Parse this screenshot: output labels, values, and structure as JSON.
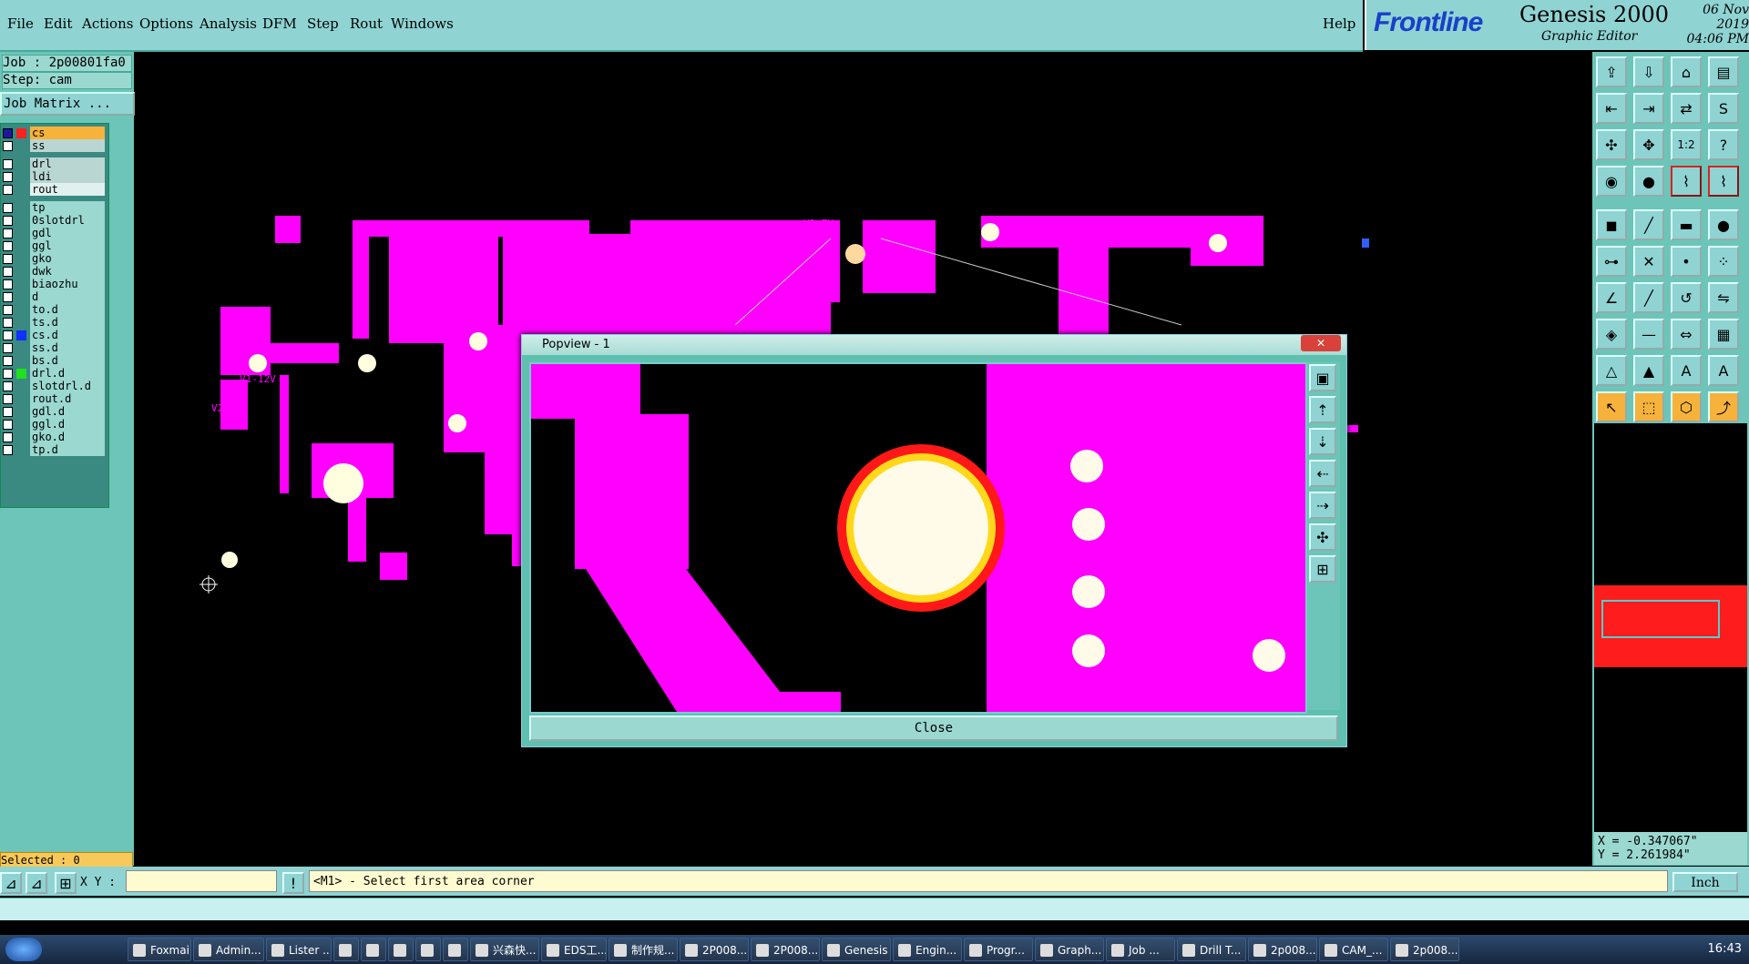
{
  "menu": [
    "File",
    "Edit",
    "Actions",
    "Options",
    "Analysis",
    "DFM",
    "Step",
    "Rout",
    "Windows"
  ],
  "help": "Help",
  "brand": {
    "logo": "Frontline",
    "product": "Genesis 2000",
    "sub": "Graphic Editor",
    "date": "06 Nov 2019",
    "time": "04:06 PM"
  },
  "job": {
    "job_line": "Job : 2p00801fa0",
    "step_line": "Step: cam",
    "matrix_button": "Job Matrix ..."
  },
  "layers": [
    {
      "name": "cs",
      "color": "#ff2020",
      "state": "active"
    },
    {
      "name": "ss",
      "color": "",
      "state": "board"
    },
    {
      "name": "drl",
      "color": "",
      "state": "board"
    },
    {
      "name": "ldi",
      "color": "",
      "state": "board"
    },
    {
      "name": "rout",
      "color": "",
      "state": "plain"
    },
    {
      "name": "tp",
      "color": "",
      "state": "misc"
    },
    {
      "name": "0slotdrl",
      "color": "",
      "state": "misc"
    },
    {
      "name": "gdl",
      "color": "",
      "state": "misc"
    },
    {
      "name": "ggl",
      "color": "",
      "state": "misc"
    },
    {
      "name": "gko",
      "color": "",
      "state": "misc"
    },
    {
      "name": "dwk",
      "color": "",
      "state": "misc"
    },
    {
      "name": "biaozhu",
      "color": "",
      "state": "misc"
    },
    {
      "name": "d",
      "color": "",
      "state": "misc"
    },
    {
      "name": "to.d",
      "color": "",
      "state": "misc"
    },
    {
      "name": "ts.d",
      "color": "",
      "state": "misc"
    },
    {
      "name": "cs.d",
      "color": "#1030ff",
      "state": "misc"
    },
    {
      "name": "ss.d",
      "color": "",
      "state": "misc"
    },
    {
      "name": "bs.d",
      "color": "",
      "state": "misc"
    },
    {
      "name": "drl.d",
      "color": "#20e020",
      "state": "misc"
    },
    {
      "name": "slotdrl.d",
      "color": "",
      "state": "misc"
    },
    {
      "name": "rout.d",
      "color": "",
      "state": "misc"
    },
    {
      "name": "gdl.d",
      "color": "",
      "state": "misc"
    },
    {
      "name": "ggl.d",
      "color": "",
      "state": "misc"
    },
    {
      "name": "gko.d",
      "color": "",
      "state": "misc"
    },
    {
      "name": "tp.d",
      "color": "",
      "state": "misc"
    }
  ],
  "selected": "Selected : 0",
  "canvas_labels": {
    "v3": "V3-7V",
    "pn": "P N:01056-",
    "v1": "V1-12V",
    "v2": "V2-7V"
  },
  "popview": {
    "title": "Popview - 1",
    "close_label": "Close"
  },
  "toolbar_icons": [
    "open-icon",
    "save-icon",
    "home-icon",
    "layout-icon",
    "import-icon",
    "export-icon",
    "exchange-icon",
    "snap-icon",
    "fit-icon",
    "zoom-fit-icon",
    "scale-1-2-icon",
    "help-icon",
    "eye-icon",
    "probe-icon",
    "layer-red-icon",
    "layer-red2-icon",
    "pad-icon",
    "line-icon",
    "bar-icon",
    "circle-icon",
    "connect-icon",
    "cross-icon",
    "point-icon",
    "points-icon",
    "angle-icon",
    "diagonal-icon",
    "arc-icon",
    "flip-icon",
    "node-icon",
    "dash-icon",
    "measure-icon",
    "array-icon",
    "triangle-icon",
    "triangle2-icon",
    "letter-a-icon",
    "letter-a2-icon",
    "select-icon",
    "select-box-icon",
    "select-poly-icon",
    "route-icon"
  ],
  "coords": {
    "x": "X = -0.347067\"",
    "y": "Y = 2.261984\""
  },
  "xy_label": "X Y :",
  "prompt": "<M1> - Select first area corner",
  "units": "Inch",
  "taskbar": [
    "Foxmail",
    "Admin...",
    "Lister ...",
    "",
    "",
    "",
    "",
    "",
    "兴森快...",
    "EDS工...",
    "制作规...",
    "2P008...",
    "2P008...",
    "Genesis",
    "Engin...",
    "Progr...",
    "Graph...",
    "Job ...",
    "Drill T...",
    "2p008...",
    "CAM_...",
    "2p008..."
  ],
  "clock": "16:43"
}
